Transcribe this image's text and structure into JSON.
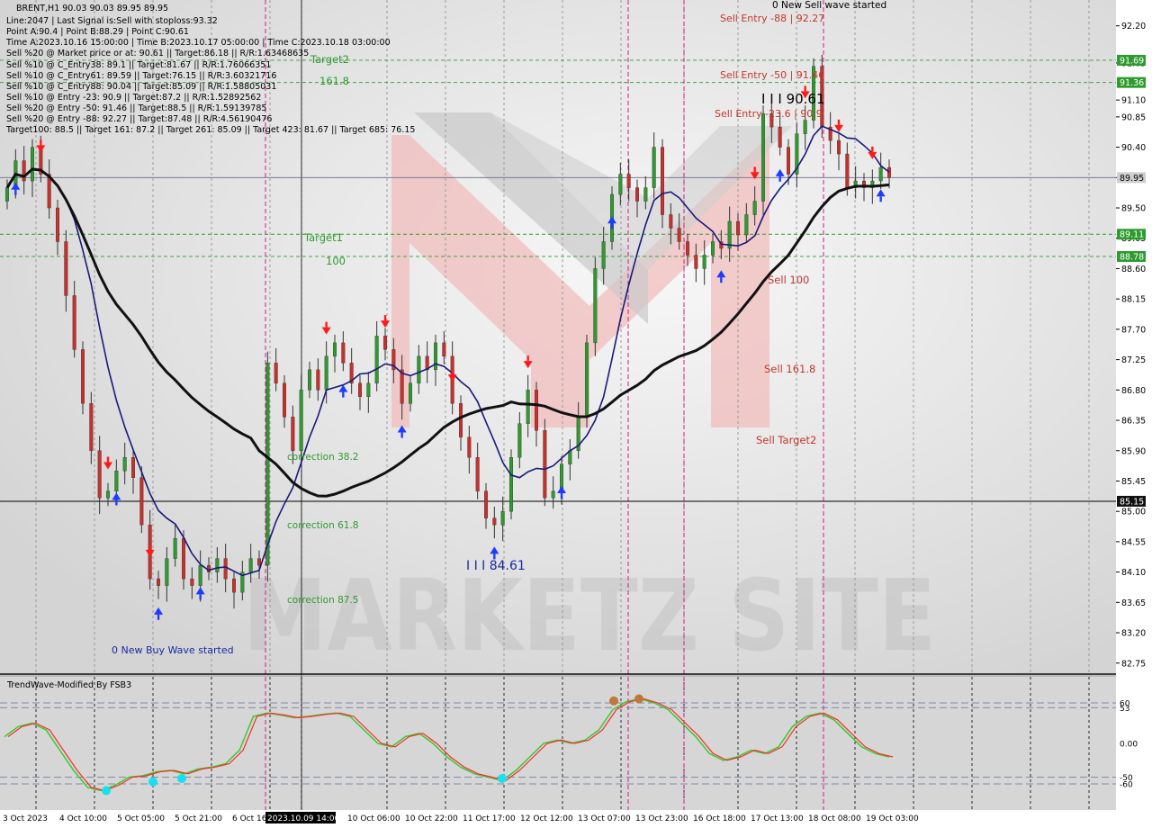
{
  "header": {
    "symbol_line": "BRENT,H1  90.03 90.03 89.95 89.95",
    "lines": [
      "Line:2047 | Last Signal is:Sell with stoploss:93.32",
      "Point A:90.4 | Point B:88.29 | Point C:90.61",
      "Time A:2023.10.16 15:00:00 | Time B:2023.10.17 05:00:00 | Time C:2023.10.18 03:00:00",
      "Sell %20 @ Market price or at: 90.61 || Target:86.18 || R/R:1.63468635",
      "Sell %10 @ C_Entry38: 89.1 || Target:81.67 || R/R:1.76066351",
      "Sell %10 @ C_Entry61: 89.59 || Target:76.15 || R/R:3.60321716",
      "Sell %10 @ C_Entry88: 90.04 || Target:85.09 || R/R:1.58805031",
      "Sell %10 @ Entry -23: 90.9 || Target:87.2 || R/R:1.52892562",
      "Sell %20 @ Entry -50: 91.46 || Target:88.5 || R/R:1.59139785",
      "Sell %20 @ Entry -88: 92.27 || Target:87.48 || R/R:4.56190476",
      "Target100: 88.5 || Target 161: 87.2 || Target 261: 85.09 || Target 423: 81.67 || Target 685: 76.15"
    ]
  },
  "annotations": {
    "new_sell_wave": "0 New Sell wave started",
    "new_buy_wave": "0 New Buy Wave started",
    "sell_entry_88": "Sell Entry -88 | 92.27",
    "sell_entry_50": "Sell Entry -50 | 91.46",
    "sell_entry_23": "Sell Entry -23.6 | 90.9",
    "point_c": "I I I 90.61",
    "point_low": "I I I 84.61",
    "target2": "Target2",
    "target2_val": "161.8",
    "target1": "Target1",
    "target1_val": "100",
    "sell_100": "Sell 100",
    "sell_161": "Sell 161.8",
    "sell_target2": "Sell Target2",
    "correction_382": "correction 38.2",
    "correction_618": "correction 61.8",
    "correction_875": "correction 87.5",
    "watermark": "MARKETZ SITE"
  },
  "price_axis": {
    "ticks": [
      "92.20",
      "91.65",
      "91.10",
      "90.85",
      "90.40",
      "89.95",
      "89.50",
      "89.05",
      "88.60",
      "88.15",
      "87.70",
      "87.25",
      "86.80",
      "86.35",
      "85.90",
      "85.45",
      "85.00",
      "84.55",
      "84.10",
      "83.65",
      "83.20",
      "82.75"
    ],
    "badges": [
      {
        "label": "91.69",
        "value": 91.69,
        "color": "#2e9b2e"
      },
      {
        "label": "91.36",
        "value": 91.36,
        "color": "#2e9b2e"
      },
      {
        "label": "89.95",
        "value": 89.95,
        "color": "#cfcfcf"
      },
      {
        "label": "89.11",
        "value": 89.11,
        "color": "#2e9b2e"
      },
      {
        "label": "88.78",
        "value": 88.78,
        "color": "#2e9b2e"
      },
      {
        "label": "85.15",
        "value": 85.15,
        "color": "#111111"
      }
    ]
  },
  "time_axis": {
    "labels": [
      "3 Oct 2023",
      "4 Oct 10:00",
      "5 Oct 05:00",
      "5 Oct 21:00",
      "6 Oct 16:00",
      "2023.10.09 14:00",
      "10 Oct 06:00",
      "10 Oct 22:00",
      "11 Oct 17:00",
      "12 Oct 12:00",
      "13 Oct 07:00",
      "13 Oct 23:00",
      "16 Oct 18:00",
      "17 Oct 13:00",
      "18 Oct 08:00",
      "19 Oct 03:00"
    ]
  },
  "indicator": {
    "title": "TrendWave-Modified By FSB3",
    "ticks": [
      "60",
      "53",
      "0.00",
      "-50",
      "-60"
    ]
  },
  "colors": {
    "bull": "#2e9b2e",
    "bear": "#c9302c",
    "ma_fast": "#1a1a7a",
    "ma_slow": "#111111",
    "osc_green": "#32cd32",
    "osc_red": "#ff2a2a",
    "arrow_up": "#1e3cff",
    "arrow_down": "#ff1a1a"
  },
  "chart_data": {
    "type": "candlestick",
    "symbol": "BRENT",
    "timeframe": "H1",
    "ylim": [
      82.6,
      92.45
    ],
    "close_series": [
      89.8,
      90.2,
      89.9,
      90.4,
      90.0,
      89.5,
      89.0,
      88.2,
      87.4,
      86.6,
      85.9,
      85.2,
      85.3,
      85.6,
      85.8,
      85.5,
      84.8,
      84.0,
      83.9,
      84.3,
      84.6,
      84.0,
      83.9,
      84.2,
      84.1,
      84.3,
      84.0,
      83.8,
      84.1,
      84.3,
      84.2,
      87.2,
      86.9,
      86.4,
      85.9,
      86.8,
      87.1,
      86.8,
      87.3,
      87.5,
      87.2,
      86.9,
      86.7,
      86.9,
      87.6,
      87.4,
      87.1,
      86.6,
      86.9,
      87.3,
      87.1,
      87.5,
      87.3,
      86.6,
      86.1,
      85.8,
      85.3,
      84.9,
      84.8,
      85.0,
      85.8,
      86.3,
      86.8,
      86.2,
      85.2,
      85.3,
      85.7,
      85.9,
      86.4,
      87.5,
      88.6,
      89.0,
      89.7,
      90.0,
      89.8,
      89.6,
      89.8,
      90.4,
      89.4,
      89.2,
      89.0,
      88.8,
      88.6,
      88.8,
      89.0,
      88.9,
      89.3,
      89.1,
      89.4,
      89.6,
      90.9,
      90.7,
      90.4,
      90.0,
      90.6,
      90.8,
      91.6,
      90.7,
      90.5,
      90.3,
      89.8,
      89.9,
      89.8,
      89.9,
      90.1,
      89.95
    ]
  }
}
